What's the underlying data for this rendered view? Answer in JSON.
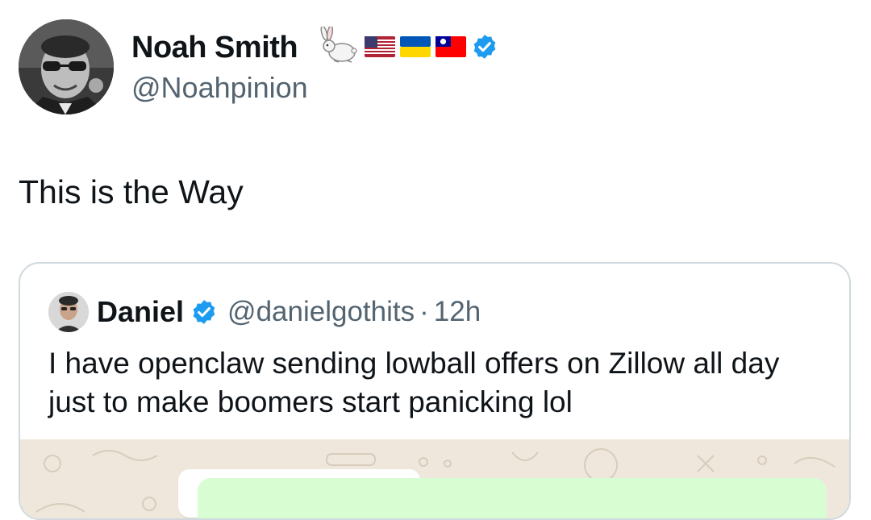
{
  "colors": {
    "text_primary": "#0f1419",
    "text_secondary": "#536471",
    "verified_blue": "#1d9bf0",
    "card_border": "#cfd9de",
    "chat_wallpaper": "#efe7dc",
    "chat_bubble_green": "#d9fdd3"
  },
  "tweet": {
    "author": {
      "name": "Noah Smith",
      "handle": "@Noahpinion",
      "name_emoji_icons": [
        "rabbit-icon",
        "us-flag-icon",
        "ukraine-flag-icon",
        "taiwan-flag-icon"
      ],
      "verified": true
    },
    "text": "This is the Way"
  },
  "quote": {
    "author": {
      "name": "Daniel",
      "handle": "@danielgothits",
      "separator": "·",
      "time": "12h",
      "verified": true
    },
    "text": "I have openclaw sending lowball offers on Zillow all day just to make boomers start panicking lol",
    "media": {
      "type": "chat-screenshot"
    }
  }
}
